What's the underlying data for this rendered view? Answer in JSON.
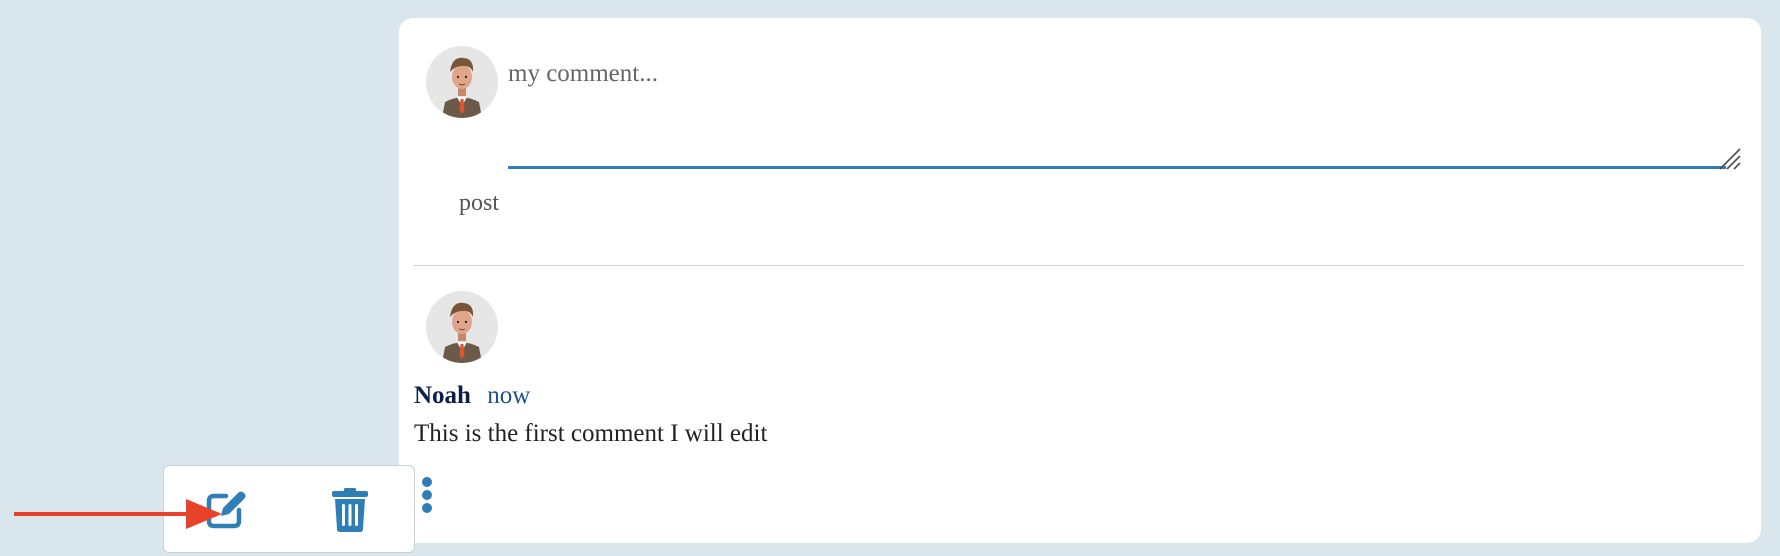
{
  "composer": {
    "placeholder": "my comment...",
    "post_label": "post"
  },
  "comment": {
    "author": "Noah",
    "timestamp": "now",
    "text": "This is the first comment I will edit"
  },
  "icons": {
    "avatar": "avatar-illustration",
    "more": "vertical-ellipsis-icon",
    "edit": "pencil-square-icon",
    "delete": "trash-icon",
    "annotation": "red-arrow"
  },
  "colors": {
    "background": "#d9e6ec",
    "accent": "#2f7fb6",
    "author": "#0c1f4a",
    "timestamp": "#1f4f8f",
    "annotation": "#e8432a"
  }
}
